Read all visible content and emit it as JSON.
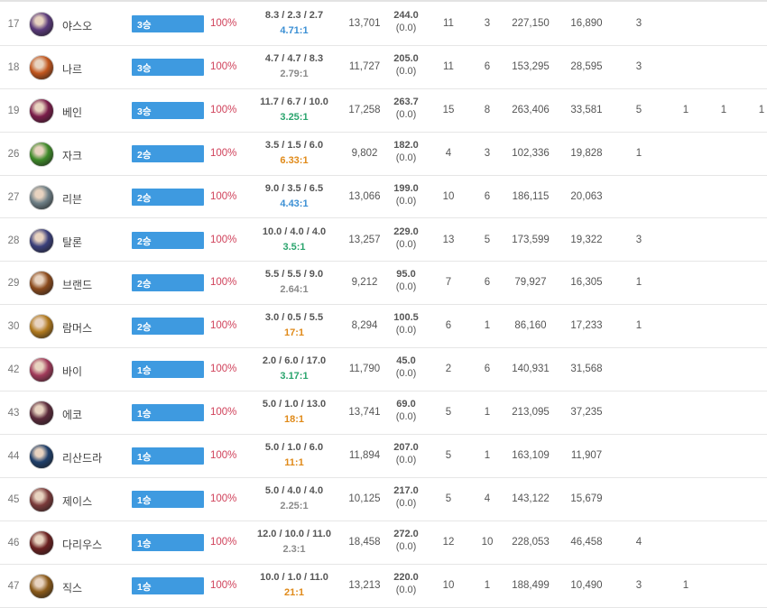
{
  "colors": {
    "bar": "#3e9ae0",
    "winrate": "#d0425b",
    "kda_gray": "#8a8a8a",
    "kda_green": "#2aa46d",
    "kda_blue": "#3b8fd4",
    "kda_orange": "#e08a19"
  },
  "rows": [
    {
      "rank": "17",
      "avatar_color": "#5a3a7a",
      "champion": "야스오",
      "wins_label": "3승",
      "winrate": "100%",
      "kda": "8.3 / 2.3 / 2.7",
      "ratio": "4.71:1",
      "ratio_color": "#3b8fd4",
      "gold": "13,701",
      "cs": "244.0",
      "cs_sub": "(0.0)",
      "s1": "11",
      "s2": "3",
      "dmg": "227,150",
      "dmg2": "16,890",
      "m1": "3",
      "m2": "",
      "m3": "",
      "m4": ""
    },
    {
      "rank": "18",
      "avatar_color": "#c1561e",
      "champion": "나르",
      "wins_label": "3승",
      "winrate": "100%",
      "kda": "4.7 / 4.7 / 8.3",
      "ratio": "2.79:1",
      "ratio_color": "#8a8a8a",
      "gold": "11,727",
      "cs": "205.0",
      "cs_sub": "(0.0)",
      "s1": "11",
      "s2": "6",
      "dmg": "153,295",
      "dmg2": "28,595",
      "m1": "3",
      "m2": "",
      "m3": "",
      "m4": ""
    },
    {
      "rank": "19",
      "avatar_color": "#7a1d4a",
      "champion": "베인",
      "wins_label": "3승",
      "winrate": "100%",
      "kda": "11.7 / 6.7 / 10.0",
      "ratio": "3.25:1",
      "ratio_color": "#2aa46d",
      "gold": "17,258",
      "cs": "263.7",
      "cs_sub": "(0.0)",
      "s1": "15",
      "s2": "8",
      "dmg": "263,406",
      "dmg2": "33,581",
      "m1": "5",
      "m2": "1",
      "m3": "1",
      "m4": "1"
    },
    {
      "rank": "26",
      "avatar_color": "#3f8a2a",
      "champion": "자크",
      "wins_label": "2승",
      "winrate": "100%",
      "kda": "3.5 / 1.5 / 6.0",
      "ratio": "6.33:1",
      "ratio_color": "#e08a19",
      "gold": "9,802",
      "cs": "182.0",
      "cs_sub": "(0.0)",
      "s1": "4",
      "s2": "3",
      "dmg": "102,336",
      "dmg2": "19,828",
      "m1": "1",
      "m2": "",
      "m3": "",
      "m4": ""
    },
    {
      "rank": "27",
      "avatar_color": "#6e7f86",
      "champion": "리븐",
      "wins_label": "2승",
      "winrate": "100%",
      "kda": "9.0 / 3.5 / 6.5",
      "ratio": "4.43:1",
      "ratio_color": "#3b8fd4",
      "gold": "13,066",
      "cs": "199.0",
      "cs_sub": "(0.0)",
      "s1": "10",
      "s2": "6",
      "dmg": "186,115",
      "dmg2": "20,063",
      "m1": "",
      "m2": "",
      "m3": "",
      "m4": ""
    },
    {
      "rank": "28",
      "avatar_color": "#3a3f7a",
      "champion": "탈론",
      "wins_label": "2승",
      "winrate": "100%",
      "kda": "10.0 / 4.0 / 4.0",
      "ratio": "3.5:1",
      "ratio_color": "#2aa46d",
      "gold": "13,257",
      "cs": "229.0",
      "cs_sub": "(0.0)",
      "s1": "13",
      "s2": "5",
      "dmg": "173,599",
      "dmg2": "19,322",
      "m1": "3",
      "m2": "",
      "m3": "",
      "m4": ""
    },
    {
      "rank": "29",
      "avatar_color": "#8a4a1c",
      "champion": "브랜드",
      "wins_label": "2승",
      "winrate": "100%",
      "kda": "5.5 / 5.5 / 9.0",
      "ratio": "2.64:1",
      "ratio_color": "#8a8a8a",
      "gold": "9,212",
      "cs": "95.0",
      "cs_sub": "(0.0)",
      "s1": "7",
      "s2": "6",
      "dmg": "79,927",
      "dmg2": "16,305",
      "m1": "1",
      "m2": "",
      "m3": "",
      "m4": ""
    },
    {
      "rank": "30",
      "avatar_color": "#b0791e",
      "champion": "람머스",
      "wins_label": "2승",
      "winrate": "100%",
      "kda": "3.0 / 0.5 / 5.5",
      "ratio": "17:1",
      "ratio_color": "#e08a19",
      "gold": "8,294",
      "cs": "100.5",
      "cs_sub": "(0.0)",
      "s1": "6",
      "s2": "1",
      "dmg": "86,160",
      "dmg2": "17,233",
      "m1": "1",
      "m2": "",
      "m3": "",
      "m4": ""
    },
    {
      "rank": "42",
      "avatar_color": "#a03a5a",
      "champion": "바이",
      "wins_label": "1승",
      "winrate": "100%",
      "kda": "2.0 / 6.0 / 17.0",
      "ratio": "3.17:1",
      "ratio_color": "#2aa46d",
      "gold": "11,790",
      "cs": "45.0",
      "cs_sub": "(0.0)",
      "s1": "2",
      "s2": "6",
      "dmg": "140,931",
      "dmg2": "31,568",
      "m1": "",
      "m2": "",
      "m3": "",
      "m4": ""
    },
    {
      "rank": "43",
      "avatar_color": "#5a2a3a",
      "champion": "에코",
      "wins_label": "1승",
      "winrate": "100%",
      "kda": "5.0 / 1.0 / 13.0",
      "ratio": "18:1",
      "ratio_color": "#e08a19",
      "gold": "13,741",
      "cs": "69.0",
      "cs_sub": "(0.0)",
      "s1": "5",
      "s2": "1",
      "dmg": "213,095",
      "dmg2": "37,235",
      "m1": "",
      "m2": "",
      "m3": "",
      "m4": ""
    },
    {
      "rank": "44",
      "avatar_color": "#1f3f6a",
      "champion": "리산드라",
      "wins_label": "1승",
      "winrate": "100%",
      "kda": "5.0 / 1.0 / 6.0",
      "ratio": "11:1",
      "ratio_color": "#e08a19",
      "gold": "11,894",
      "cs": "207.0",
      "cs_sub": "(0.0)",
      "s1": "5",
      "s2": "1",
      "dmg": "163,109",
      "dmg2": "11,907",
      "m1": "",
      "m2": "",
      "m3": "",
      "m4": ""
    },
    {
      "rank": "45",
      "avatar_color": "#7a3a3a",
      "champion": "제이스",
      "wins_label": "1승",
      "winrate": "100%",
      "kda": "5.0 / 4.0 / 4.0",
      "ratio": "2.25:1",
      "ratio_color": "#8a8a8a",
      "gold": "10,125",
      "cs": "217.0",
      "cs_sub": "(0.0)",
      "s1": "5",
      "s2": "4",
      "dmg": "143,122",
      "dmg2": "15,679",
      "m1": "",
      "m2": "",
      "m3": "",
      "m4": ""
    },
    {
      "rank": "46",
      "avatar_color": "#6a2020",
      "champion": "다리우스",
      "wins_label": "1승",
      "winrate": "100%",
      "kda": "12.0 / 10.0 / 11.0",
      "ratio": "2.3:1",
      "ratio_color": "#8a8a8a",
      "gold": "18,458",
      "cs": "272.0",
      "cs_sub": "(0.0)",
      "s1": "12",
      "s2": "10",
      "dmg": "228,053",
      "dmg2": "46,458",
      "m1": "4",
      "m2": "",
      "m3": "",
      "m4": ""
    },
    {
      "rank": "47",
      "avatar_color": "#8a5a1a",
      "champion": "직스",
      "wins_label": "1승",
      "winrate": "100%",
      "kda": "10.0 / 1.0 / 11.0",
      "ratio": "21:1",
      "ratio_color": "#e08a19",
      "gold": "13,213",
      "cs": "220.0",
      "cs_sub": "(0.0)",
      "s1": "10",
      "s2": "1",
      "dmg": "188,499",
      "dmg2": "10,490",
      "m1": "3",
      "m2": "1",
      "m3": "",
      "m4": ""
    }
  ]
}
